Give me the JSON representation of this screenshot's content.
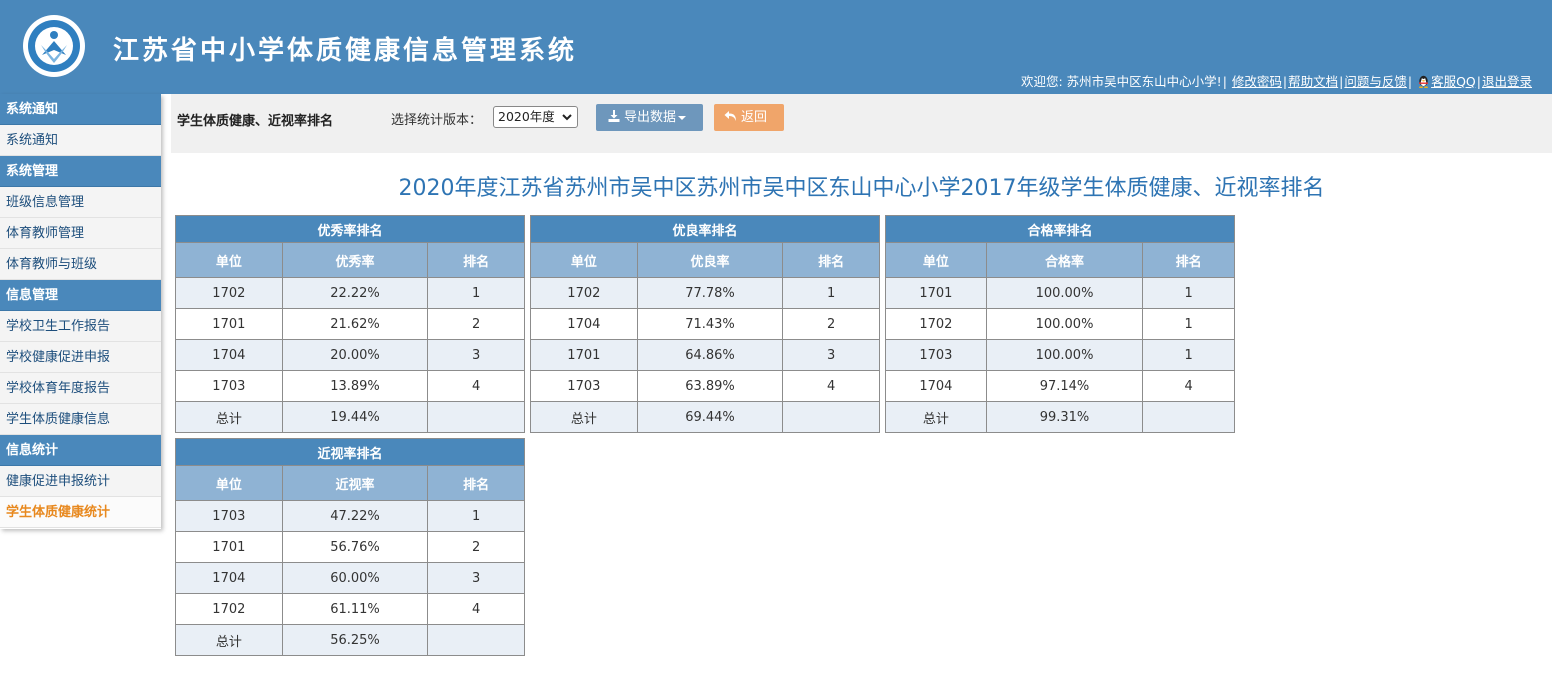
{
  "header": {
    "title": "江苏省中小学体质健康信息管理系统",
    "welcome": "欢迎您: 苏州市吴中区东山中心小学!",
    "links": [
      "修改密码",
      "帮助文档",
      "问题与反馈",
      "客服QQ",
      "退出登录"
    ]
  },
  "sidebar": {
    "groups": [
      {
        "title": "系统通知",
        "items": [
          "系统通知"
        ]
      },
      {
        "title": "系统管理",
        "items": [
          "班级信息管理",
          "体育教师管理",
          "体育教师与班级"
        ]
      },
      {
        "title": "信息管理",
        "items": [
          "学校卫生工作报告",
          "学校健康促进申报",
          "学校体育年度报告",
          "学生体质健康信息"
        ]
      },
      {
        "title": "信息统计",
        "items": [
          "健康促进申报统计",
          "学生体质健康统计"
        ]
      }
    ],
    "active_item": "学生体质健康统计"
  },
  "toolbar": {
    "page_title": "学生体质健康、近视率排名",
    "version_label": "选择统计版本：",
    "version_value": "2020年度",
    "export_label": "导出数据",
    "back_label": "返回"
  },
  "report": {
    "title": "2020年度江苏省苏州市吴中区苏州市吴中区东山中心小学2017年级学生体质健康、近视率排名",
    "tables": [
      {
        "caption": "优秀率排名",
        "headers": [
          "单位",
          "优秀率",
          "排名"
        ],
        "rows": [
          [
            "1702",
            "22.22%",
            "1"
          ],
          [
            "1701",
            "21.62%",
            "2"
          ],
          [
            "1704",
            "20.00%",
            "3"
          ],
          [
            "1703",
            "13.89%",
            "4"
          ]
        ],
        "total": [
          "总计",
          "19.44%",
          ""
        ]
      },
      {
        "caption": "优良率排名",
        "headers": [
          "单位",
          "优良率",
          "排名"
        ],
        "rows": [
          [
            "1702",
            "77.78%",
            "1"
          ],
          [
            "1704",
            "71.43%",
            "2"
          ],
          [
            "1701",
            "64.86%",
            "3"
          ],
          [
            "1703",
            "63.89%",
            "4"
          ]
        ],
        "total": [
          "总计",
          "69.44%",
          ""
        ]
      },
      {
        "caption": "合格率排名",
        "headers": [
          "单位",
          "合格率",
          "排名"
        ],
        "rows": [
          [
            "1701",
            "100.00%",
            "1"
          ],
          [
            "1702",
            "100.00%",
            "1"
          ],
          [
            "1703",
            "100.00%",
            "1"
          ],
          [
            "1704",
            "97.14%",
            "4"
          ]
        ],
        "total": [
          "总计",
          "99.31%",
          ""
        ]
      },
      {
        "caption": "近视率排名",
        "headers": [
          "单位",
          "近视率",
          "排名"
        ],
        "rows": [
          [
            "1703",
            "47.22%",
            "1"
          ],
          [
            "1701",
            "56.76%",
            "2"
          ],
          [
            "1704",
            "60.00%",
            "3"
          ],
          [
            "1702",
            "61.11%",
            "4"
          ]
        ],
        "total": [
          "总计",
          "56.25%",
          ""
        ]
      }
    ]
  },
  "colors": {
    "header_bg": "#4a88bb",
    "table_header": "#8fb3d4",
    "export_button": "#6e97bc",
    "back_button": "#f0a56a",
    "active_menu": "#e8891f",
    "report_title": "#2e74b3"
  }
}
